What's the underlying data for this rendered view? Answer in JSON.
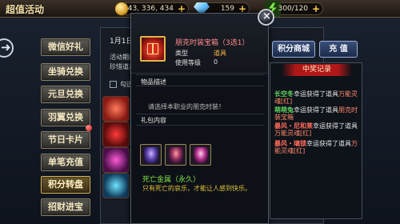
{
  "page_title": "超值活动",
  "resources": {
    "gold": {
      "value": "43, 336, 434",
      "icon": "gold-coin-icon"
    },
    "gems": {
      "value": "159",
      "icon": "diamond-icon"
    },
    "stamina": {
      "value": "300/120",
      "icon": "stamina-icon"
    },
    "plus": "+"
  },
  "dock_arrow": "➜",
  "side_nav": [
    {
      "label": "微信好礼",
      "active": false
    },
    {
      "label": "坐骑兑换",
      "active": false
    },
    {
      "label": "元旦兑换",
      "active": false
    },
    {
      "label": "羽翼兑换",
      "active": false
    },
    {
      "label": "节日卡片",
      "active": false
    },
    {
      "label": "单笔充值",
      "active": false
    },
    {
      "label": "积分转盘",
      "active": true
    },
    {
      "label": "招财进宝",
      "active": false
    }
  ],
  "background_panel": {
    "date": "1月1日",
    "line1": "活动期间",
    "line2": "珍惜道具",
    "checkbox_label": "勾选"
  },
  "popup": {
    "item_name": "朋克时装宝箱（3选1）",
    "type_label": "类型",
    "type_value": "道具",
    "level_label": "使用等级",
    "level_value": "0",
    "desc_title": "物品描述",
    "desc_text": "请选择本职业的朋克时装！",
    "contents_title": "礼包内容",
    "set_name": "死亡金属（永久）",
    "set_desc": "只有死亡的哀乐，才能让人感到快乐。",
    "close_icon": "×"
  },
  "buttons": {
    "shop": "积分商城",
    "charge": "充  值"
  },
  "records": {
    "title": "中奖记录",
    "entries": [
      {
        "who": "长空冬",
        "who_color": "#5fd35f",
        "text": "幸运获得了道具",
        "item": "万能灵魂[红]"
      },
      {
        "who": "萌萌兔",
        "who_color": "#5fd35f",
        "text": "幸运获得了道具",
        "item": "朋克时装宝箱"
      },
      {
        "who": "暴风・尼和莱",
        "who_color": "#ff6a5a",
        "text": "幸运获得了道具",
        "item": "万能灵魂[红]"
      },
      {
        "who": "暴风・璃锁",
        "who_color": "#ff6a5a",
        "text": "幸运获得了道具",
        "item": "万能灵魂[红]"
      }
    ]
  }
}
